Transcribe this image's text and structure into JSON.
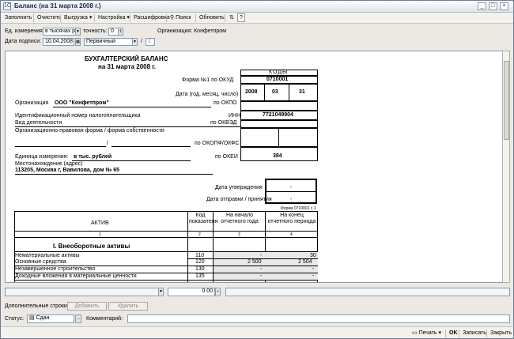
{
  "window": {
    "title": "Баланс (на 31 марта 2008 г.)",
    "min": "_",
    "max": "□",
    "close": "×"
  },
  "toolbar": {
    "fill": "Заполнить",
    "clear": "Очистить",
    "export": "Выгрузка ▾",
    "settings": "Настройка ▾",
    "decode": "Расшифровка",
    "search": "Поиск",
    "refresh": "Обновить",
    "help": "?"
  },
  "params": {
    "unit_label": "Ед. измерения:",
    "unit_value": "в тысячах р",
    "precision_label": "точность:",
    "precision_value": "0",
    "org_label": "Организация: Конфетпром",
    "sign_date_label": "Дата подписи:",
    "sign_date": "10.04.2008",
    "kind": "Первичный",
    "slash": "/",
    "page": "1"
  },
  "doc": {
    "title1": "БУХГАЛТЕРСКИЙ БАЛАНС",
    "title2": "на 31 марта 2008 г.",
    "codes_head": "КОДЫ",
    "okud_label": "Форма №1 по ОКУД",
    "okud": "0710001",
    "date_label": "Дата (год, месяц, число)",
    "year": "2008",
    "month": "03",
    "day": "31",
    "org_lbl": "Организация",
    "org_name": "ООО \"Конфетпром\"",
    "okpo_lbl": "по ОКПО",
    "inn_lbl_left": "Идентификационный номер налогоплательщика",
    "inn_lbl": "ИНН",
    "inn": "7721049904",
    "activity_lbl": "Вид деятельности",
    "okved_lbl": "по ОКВЭД",
    "opf_lbl": "Организационно-правовая форма / форма собственности",
    "slash": "/",
    "okopf_lbl": "по ОКОПФ/ОКФС",
    "unit_lbl": "Единица измерения:",
    "unit_val": "в тыс. рублей",
    "okei_lbl": "по ОКЕИ",
    "okei": "384",
    "addr_lbl": "Местонахождение (адрес)",
    "addr": "113205, Москва г, Вавилова, дом № 65",
    "approve_lbl": "Дата утверждения",
    "approve_val": "-",
    "send_lbl": "Дата отправки / принятия",
    "send_val": "-",
    "form_note": "Форма 0710001 с.1",
    "col_asset": "АКТИВ",
    "col_code": "Код показателя",
    "col_start": "На начало отчетного года",
    "col_end": "На конец отчетного периода",
    "n1": "1",
    "n2": "2",
    "n3": "3",
    "n4": "4",
    "section1": "I. Внеоборотные активы",
    "rows": [
      {
        "name": "Нематериальные активы",
        "code": "110",
        "start": "-",
        "end": "30"
      },
      {
        "name": "Основные средства",
        "code": "120",
        "start": "2 500",
        "end": "2 504"
      },
      {
        "name": "Незавершенное строительство",
        "code": "130",
        "start": "-",
        "end": "-"
      },
      {
        "name": "Доходные вложения в материальные ценности",
        "code": "135",
        "start": "-",
        "end": "-"
      }
    ]
  },
  "bottom": {
    "sum": "0.00",
    "extra_label": "Дополнительные строки:",
    "add": "Добавить",
    "remove": "Удалить",
    "status_label": "Статус:",
    "status_value": "Сдан",
    "comment_label": "Комментарий:"
  },
  "footer": {
    "print": "Печать ▾",
    "ok": "OK",
    "save": "Записать",
    "close": "Закрыть"
  }
}
